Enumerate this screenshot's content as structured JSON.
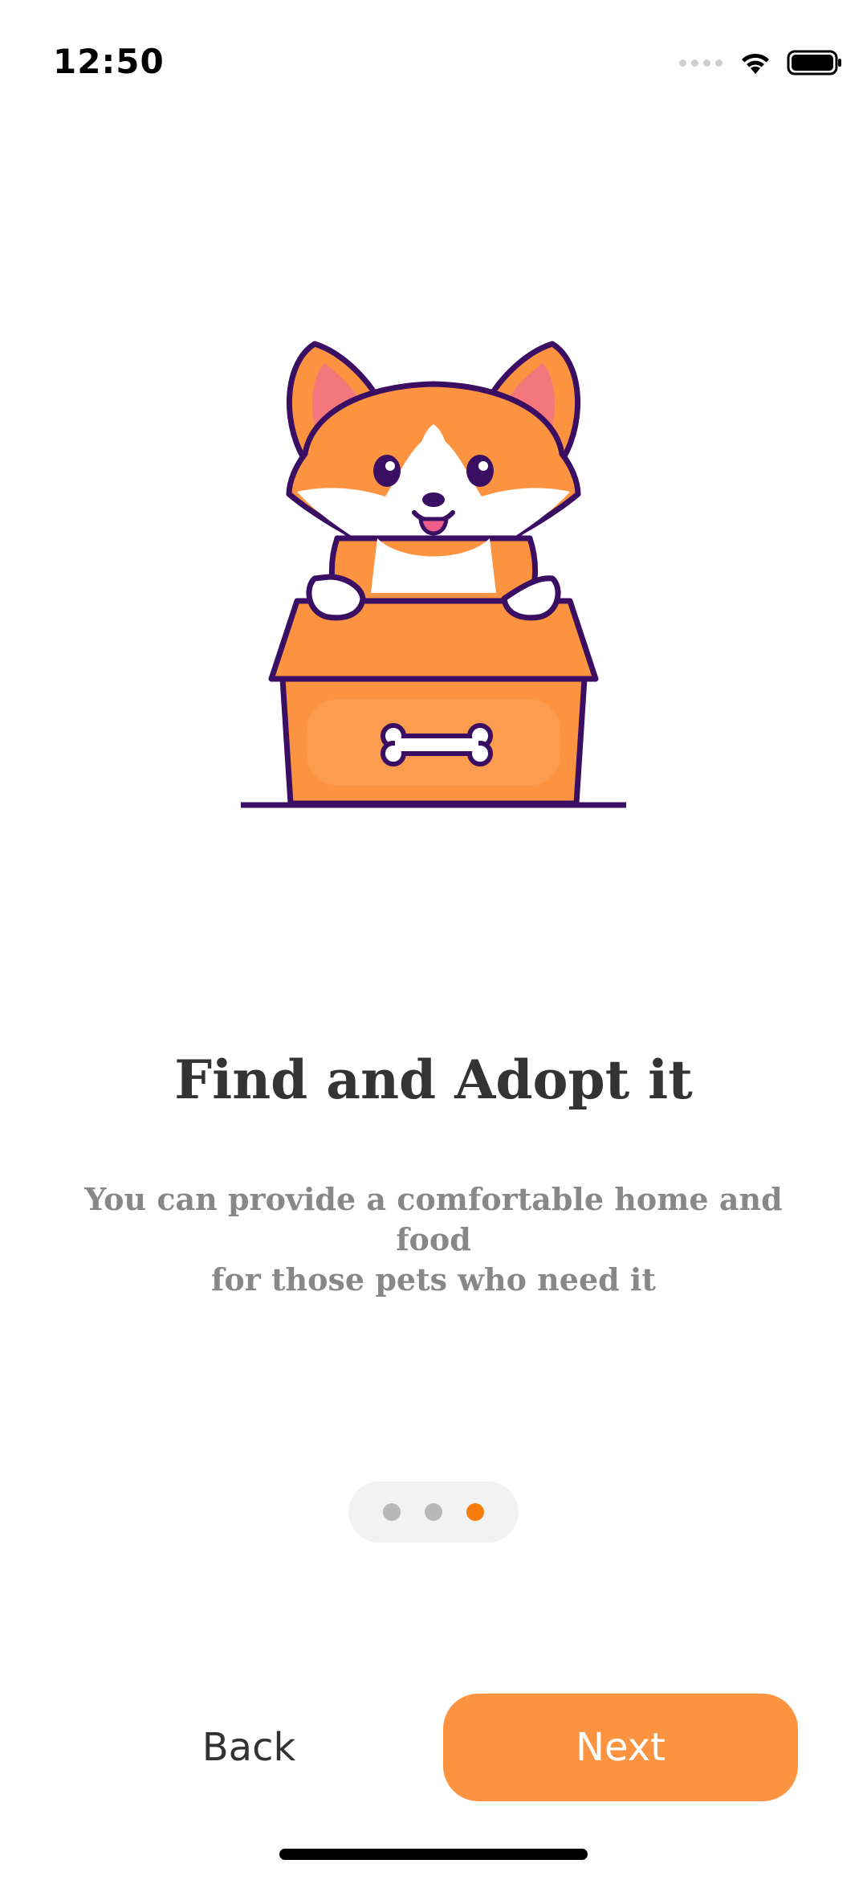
{
  "status_bar": {
    "time": "12:50",
    "icons": [
      "signal-dots-icon",
      "wifi-icon",
      "battery-icon"
    ]
  },
  "hero": {
    "illustration": "corgi-in-box-illustration"
  },
  "onboarding": {
    "title": "Find and Adopt it",
    "subtitle_line1": "You can provide a comfortable home and food",
    "subtitle_line2": "for those pets who need it"
  },
  "pager": {
    "total": 3,
    "active_index": 2
  },
  "actions": {
    "back_label": "Back",
    "next_label": "Next"
  },
  "colors": {
    "accent": "#fb9341",
    "active_dot": "#f67c0c",
    "title": "#333333",
    "subtitle": "#888888",
    "inactive_dot": "#b8b8b8"
  }
}
